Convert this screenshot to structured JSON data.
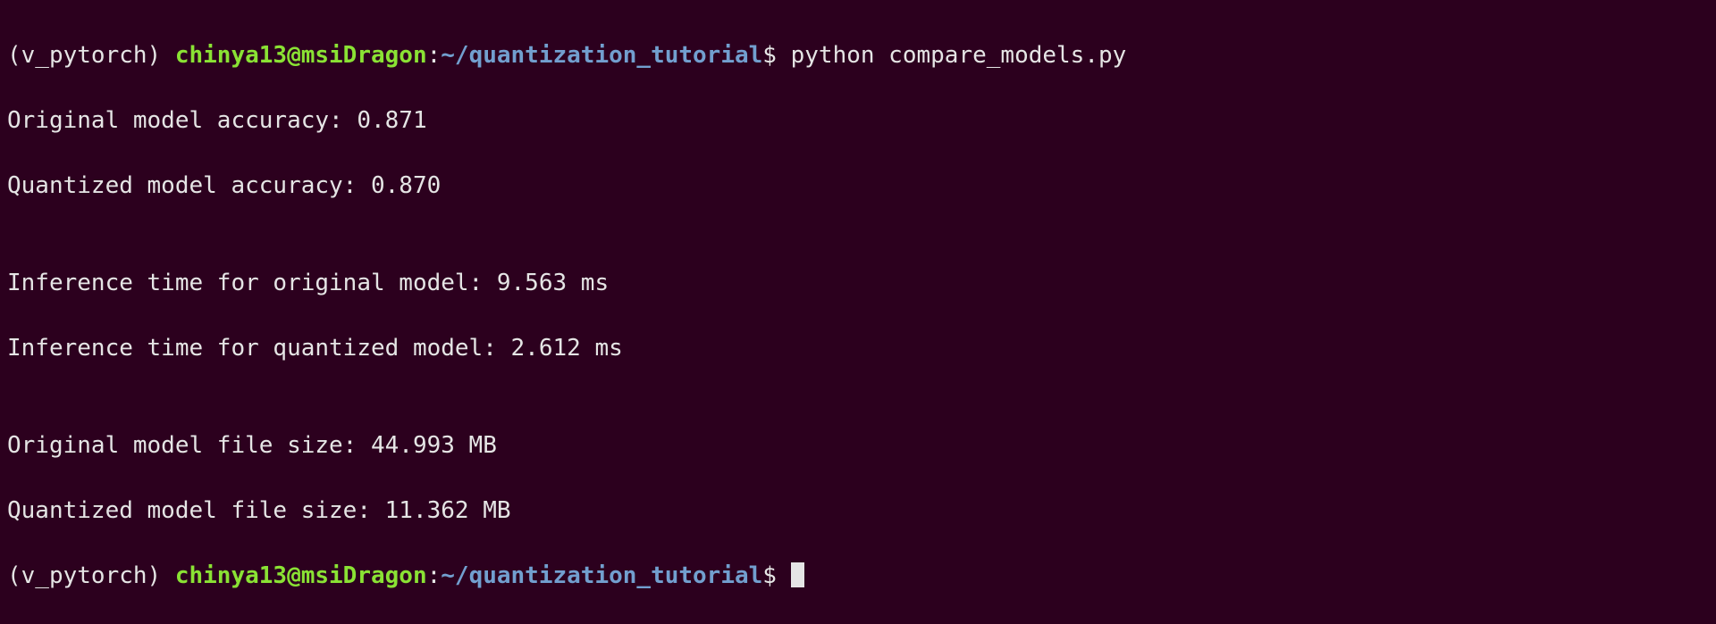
{
  "prompt1": {
    "env": "(v_pytorch) ",
    "userhost": "chinya13@msiDragon",
    "colon": ":",
    "path": "~/quantization_tutorial",
    "dollar": "$ ",
    "command": "python compare_models.py"
  },
  "output": {
    "line1": "Original model accuracy: 0.871",
    "line2": "Quantized model accuracy: 0.870",
    "line3": "",
    "line4": "Inference time for original model: 9.563 ms",
    "line5": "Inference time for quantized model: 2.612 ms",
    "line6": "",
    "line7": "Original model file size: 44.993 MB",
    "line8": "Quantized model file size: 11.362 MB"
  },
  "prompt2": {
    "env": "(v_pytorch) ",
    "userhost": "chinya13@msiDragon",
    "colon": ":",
    "path": "~/quantization_tutorial",
    "dollar": "$ "
  }
}
